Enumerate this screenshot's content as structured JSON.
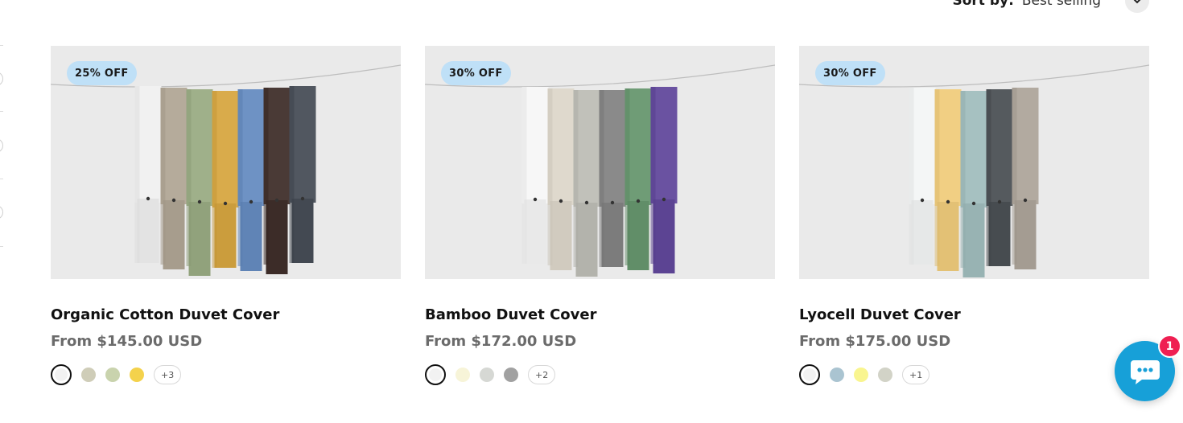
{
  "sort": {
    "label": "Sort by:",
    "value": "Best selling",
    "icon": "chevron-down-icon"
  },
  "products": [
    {
      "badge": "25% OFF",
      "title": "Organic Cotton Duvet Cover",
      "price": "From $145.00 USD",
      "fabric_colors": [
        "#f1f1f1",
        "#b5ab9b",
        "#9fb08a",
        "#d9ab4b",
        "#6e92c4",
        "#4a3a36",
        "#515760"
      ],
      "swatches": [
        {
          "color": "#f2f2f2",
          "selected": true
        },
        {
          "color": "#cfcdb8",
          "selected": false
        },
        {
          "color": "#c9d3ad",
          "selected": false
        },
        {
          "color": "#f4d24c",
          "selected": false
        }
      ],
      "more": "+3"
    },
    {
      "badge": "30% OFF",
      "title": "Bamboo Duvet Cover",
      "price": "From $172.00 USD",
      "fabric_colors": [
        "#f7f7f7",
        "#dfd9cd",
        "#c1c1ba",
        "#8a8a8a",
        "#6f9c76",
        "#6a52a1"
      ],
      "swatches": [
        {
          "color": "#f2f2f2",
          "selected": true
        },
        {
          "color": "#f7f4d8",
          "selected": false
        },
        {
          "color": "#d6d8d4",
          "selected": false
        },
        {
          "color": "#a1a1a1",
          "selected": false
        }
      ],
      "more": "+2"
    },
    {
      "badge": "30% OFF",
      "title": "Lyocell Duvet Cover",
      "price": "From $175.00 USD",
      "fabric_colors": [
        "#f4f6f6",
        "#f1cf83",
        "#a6c1c1",
        "#555a5e",
        "#b2aaa0"
      ],
      "swatches": [
        {
          "color": "#f2f2f2",
          "selected": true
        },
        {
          "color": "#aac4d1",
          "selected": false
        },
        {
          "color": "#f9f58f",
          "selected": false
        },
        {
          "color": "#d2d3c7",
          "selected": false
        }
      ],
      "more": "+1"
    }
  ],
  "chat": {
    "icon": "chat-bubble-icon",
    "badge_count": "1",
    "color": "#17a0d8"
  }
}
